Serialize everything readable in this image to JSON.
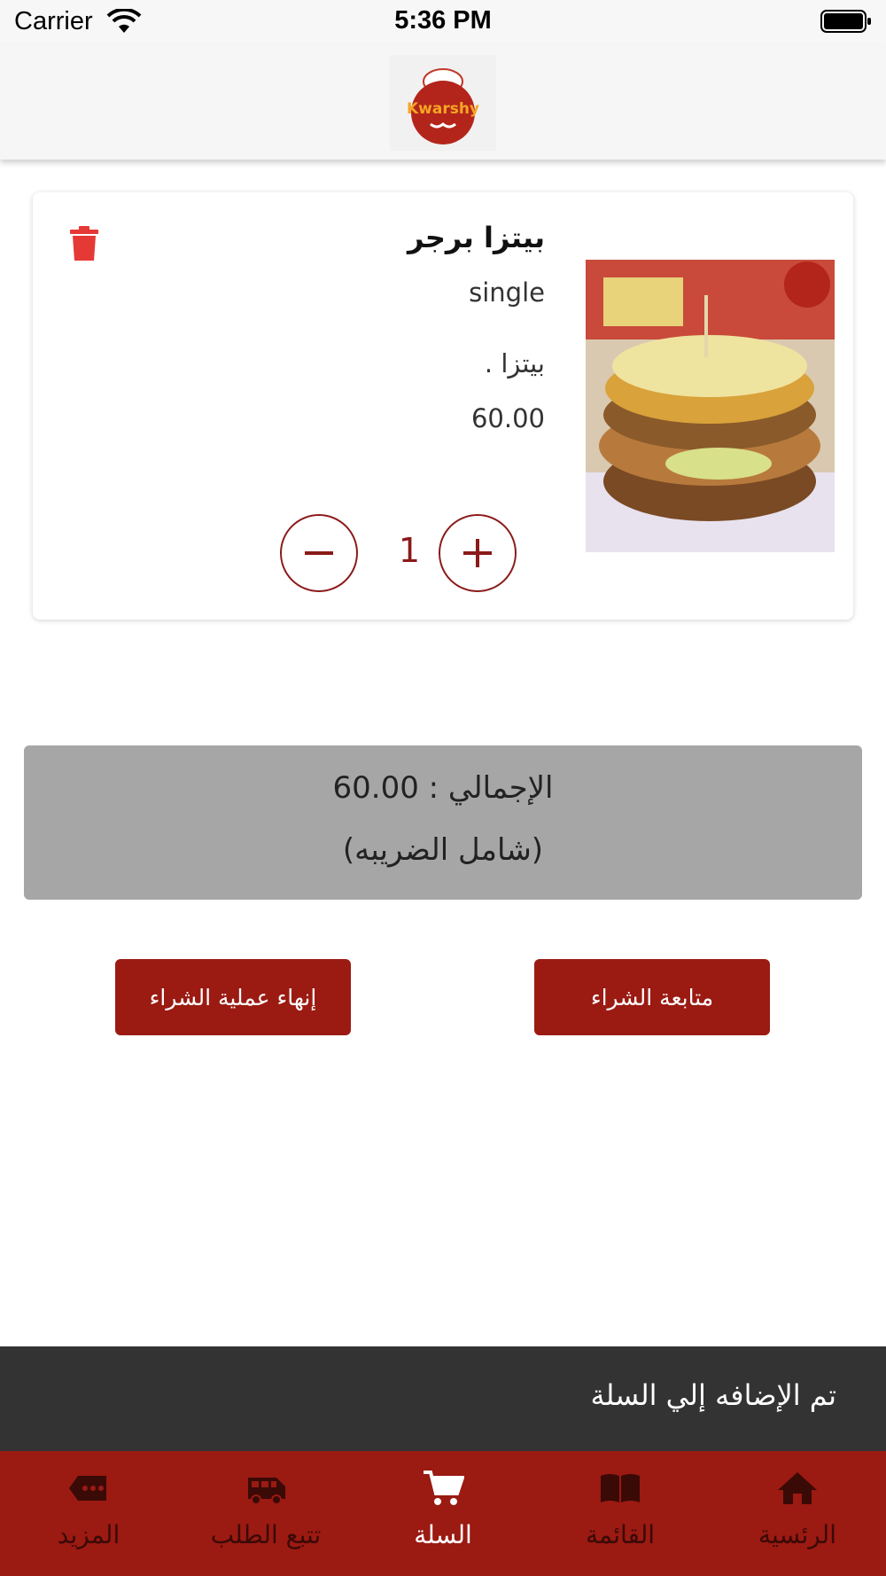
{
  "status_bar": {
    "carrier": "Carrier",
    "time": "5:36 PM"
  },
  "header": {
    "logo_icon": "kwarshy-logo",
    "logo_text": "Kwarshy"
  },
  "cart": {
    "items": [
      {
        "name": "بيتزا برجر",
        "size": "single",
        "description": "بيتزا .",
        "price": "60.00",
        "quantity": "1",
        "image_icon": "burger-photo"
      }
    ]
  },
  "summary": {
    "total_line": "الإجمالي : 60.00",
    "tax_note": "(شامل الضريبه)"
  },
  "actions": {
    "finish_label": "إنهاء عملية الشراء",
    "continue_label": "متابعة الشراء"
  },
  "toast": {
    "message": "تم الإضافه إلي السلة"
  },
  "bottom_nav": {
    "items": [
      {
        "label": "المزيد",
        "icon": "more-icon",
        "active": false
      },
      {
        "label": "تتبع الطلب",
        "icon": "truck-icon",
        "active": false
      },
      {
        "label": "السلة",
        "icon": "cart-icon",
        "active": true
      },
      {
        "label": "القائمة",
        "icon": "book-icon",
        "active": false
      },
      {
        "label": "الرئسية",
        "icon": "home-icon",
        "active": false
      }
    ]
  },
  "colors": {
    "brand": "#9b1a12",
    "accent_outline": "#8b1a1a",
    "delete": "#e53935",
    "toast_bg": "#333333",
    "total_bg": "#a6a6a6"
  }
}
